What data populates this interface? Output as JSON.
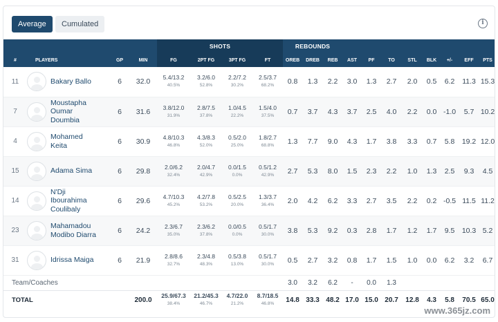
{
  "toolbar": {
    "average_label": "Average",
    "cumulated_label": "Cumulated",
    "info_glyph": "i"
  },
  "groups": {
    "shots": "SHOTS",
    "rebounds": "REBOUNDS"
  },
  "columns": [
    "#",
    "PLAYERS",
    "GP",
    "MIN",
    "FG",
    "2PT FG",
    "3PT FG",
    "FT",
    "OREB",
    "DREB",
    "REB",
    "AST",
    "PF",
    "TO",
    "STL",
    "BLK",
    "+/-",
    "EFF",
    "PTS"
  ],
  "players": [
    {
      "num": "11",
      "name": [
        "Bakary Ballo"
      ],
      "gp": "6",
      "min": "32.0",
      "fg": [
        "5.4/13.2",
        "40.5%"
      ],
      "fg2": [
        "3.2/6.0",
        "52.8%"
      ],
      "fg3": [
        "2.2/7.2",
        "30.2%"
      ],
      "ft": [
        "2.5/3.7",
        "68.2%"
      ],
      "oreb": "0.8",
      "dreb": "1.3",
      "reb": "2.2",
      "ast": "3.0",
      "pf": "1.3",
      "to": "2.7",
      "stl": "2.0",
      "blk": "0.5",
      "pm": "6.2",
      "eff": "11.3",
      "pts": "15.3"
    },
    {
      "num": "7",
      "name": [
        "Moustapha",
        "Oumar",
        "Doumbia"
      ],
      "gp": "6",
      "min": "31.6",
      "fg": [
        "3.8/12.0",
        "31.9%"
      ],
      "fg2": [
        "2.8/7.5",
        "37.8%"
      ],
      "fg3": [
        "1.0/4.5",
        "22.2%"
      ],
      "ft": [
        "1.5/4.0",
        "37.5%"
      ],
      "oreb": "0.7",
      "dreb": "3.7",
      "reb": "4.3",
      "ast": "3.7",
      "pf": "2.5",
      "to": "4.0",
      "stl": "2.2",
      "blk": "0.0",
      "pm": "-1.0",
      "eff": "5.7",
      "pts": "10.2"
    },
    {
      "num": "4",
      "name": [
        "Mohamed",
        "Keita"
      ],
      "gp": "6",
      "min": "30.9",
      "fg": [
        "4.8/10.3",
        "46.8%"
      ],
      "fg2": [
        "4.3/8.3",
        "52.0%"
      ],
      "fg3": [
        "0.5/2.0",
        "25.0%"
      ],
      "ft": [
        "1.8/2.7",
        "68.8%"
      ],
      "oreb": "1.3",
      "dreb": "7.7",
      "reb": "9.0",
      "ast": "4.3",
      "pf": "1.7",
      "to": "3.8",
      "stl": "3.3",
      "blk": "0.7",
      "pm": "5.8",
      "eff": "19.2",
      "pts": "12.0"
    },
    {
      "num": "15",
      "name": [
        "Adama Sima"
      ],
      "gp": "6",
      "min": "29.8",
      "fg": [
        "2.0/6.2",
        "32.4%"
      ],
      "fg2": [
        "2.0/4.7",
        "42.9%"
      ],
      "fg3": [
        "0.0/1.5",
        "0.0%"
      ],
      "ft": [
        "0.5/1.2",
        "42.9%"
      ],
      "oreb": "2.7",
      "dreb": "5.3",
      "reb": "8.0",
      "ast": "1.5",
      "pf": "2.3",
      "to": "2.2",
      "stl": "1.0",
      "blk": "1.3",
      "pm": "2.5",
      "eff": "9.3",
      "pts": "4.5"
    },
    {
      "num": "14",
      "name": [
        "N'Dji",
        "Ibourahima",
        "Coulibaly"
      ],
      "gp": "6",
      "min": "29.6",
      "fg": [
        "4.7/10.3",
        "45.2%"
      ],
      "fg2": [
        "4.2/7.8",
        "53.2%"
      ],
      "fg3": [
        "0.5/2.5",
        "20.0%"
      ],
      "ft": [
        "1.3/3.7",
        "36.4%"
      ],
      "oreb": "2.0",
      "dreb": "4.2",
      "reb": "6.2",
      "ast": "3.3",
      "pf": "2.7",
      "to": "3.5",
      "stl": "2.2",
      "blk": "0.2",
      "pm": "-0.5",
      "eff": "11.5",
      "pts": "11.2"
    },
    {
      "num": "23",
      "name": [
        "Mahamadou",
        "Modibo Diarra"
      ],
      "gp": "6",
      "min": "24.2",
      "fg": [
        "2.3/6.7",
        "35.0%"
      ],
      "fg2": [
        "2.3/6.2",
        "37.8%"
      ],
      "fg3": [
        "0.0/0.5",
        "0.0%"
      ],
      "ft": [
        "0.5/1.7",
        "30.0%"
      ],
      "oreb": "3.8",
      "dreb": "5.3",
      "reb": "9.2",
      "ast": "0.3",
      "pf": "2.8",
      "to": "1.7",
      "stl": "1.2",
      "blk": "1.7",
      "pm": "9.5",
      "eff": "10.3",
      "pts": "5.2"
    },
    {
      "num": "31",
      "name": [
        "Idrissa Maiga"
      ],
      "gp": "6",
      "min": "21.9",
      "fg": [
        "2.8/8.6",
        "32.7%"
      ],
      "fg2": [
        "2.3/4.8",
        "48.3%"
      ],
      "fg3": [
        "0.5/3.8",
        "13.0%"
      ],
      "ft": [
        "0.5/1.7",
        "30.0%"
      ],
      "oreb": "0.5",
      "dreb": "2.7",
      "reb": "3.2",
      "ast": "0.8",
      "pf": "1.7",
      "to": "1.5",
      "stl": "1.0",
      "blk": "0.0",
      "pm": "6.2",
      "eff": "3.2",
      "pts": "6.7"
    }
  ],
  "team": {
    "label": "Team/Coaches",
    "oreb": "3.0",
    "dreb": "3.2",
    "reb": "6.2",
    "ast": "-",
    "pf": "0.0",
    "to": "1.3"
  },
  "total": {
    "label": "TOTAL",
    "min": "200.0",
    "fg": [
      "25.9/67.3",
      "38.4%"
    ],
    "fg2": [
      "21.2/45.3",
      "46.7%"
    ],
    "fg3": [
      "4.7/22.0",
      "21.2%"
    ],
    "ft": [
      "8.7/18.5",
      "46.8%"
    ],
    "oreb": "14.8",
    "dreb": "33.3",
    "reb": "48.2",
    "ast": "17.0",
    "pf": "15.0",
    "to": "20.7",
    "stl": "12.8",
    "blk": "4.3",
    "pm": "5.8",
    "eff": "70.5",
    "pts": "65.0"
  },
  "watermark": "www.365jz.com"
}
